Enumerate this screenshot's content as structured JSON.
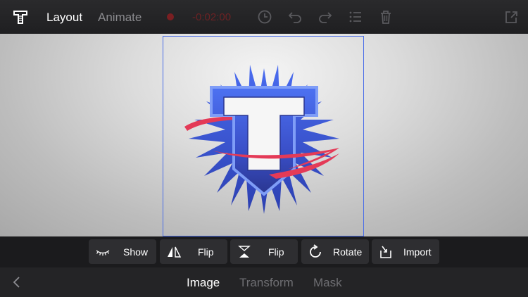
{
  "header": {
    "tabs": [
      {
        "label": "Layout",
        "active": true
      },
      {
        "label": "Animate",
        "active": false
      }
    ],
    "timecode": "-0:02:00",
    "icons": [
      "app-logo-icon",
      "record-icon",
      "clock-icon",
      "undo-icon",
      "redo-icon",
      "list-icon",
      "trash-icon",
      "share-icon"
    ]
  },
  "canvas": {
    "logo_letter": "T",
    "colors": {
      "shield": "#3f63e6",
      "shield_dark": "#2b3fa8",
      "spikes": "#3a55dd",
      "swoosh": "#e43a57",
      "selection": "#4b6ee8"
    }
  },
  "toolbar": {
    "buttons": [
      {
        "label": "Show",
        "icon": "eye-closed-icon"
      },
      {
        "label": "Flip",
        "icon": "flip-horizontal-icon"
      },
      {
        "label": "Flip",
        "icon": "flip-vertical-icon"
      },
      {
        "label": "Rotate",
        "icon": "rotate-icon"
      },
      {
        "label": "Import",
        "icon": "import-icon"
      }
    ]
  },
  "bottom": {
    "back_icon": "chevron-left-icon",
    "tabs": [
      {
        "label": "Image",
        "active": true
      },
      {
        "label": "Transform",
        "active": false
      },
      {
        "label": "Mask",
        "active": false
      }
    ]
  }
}
